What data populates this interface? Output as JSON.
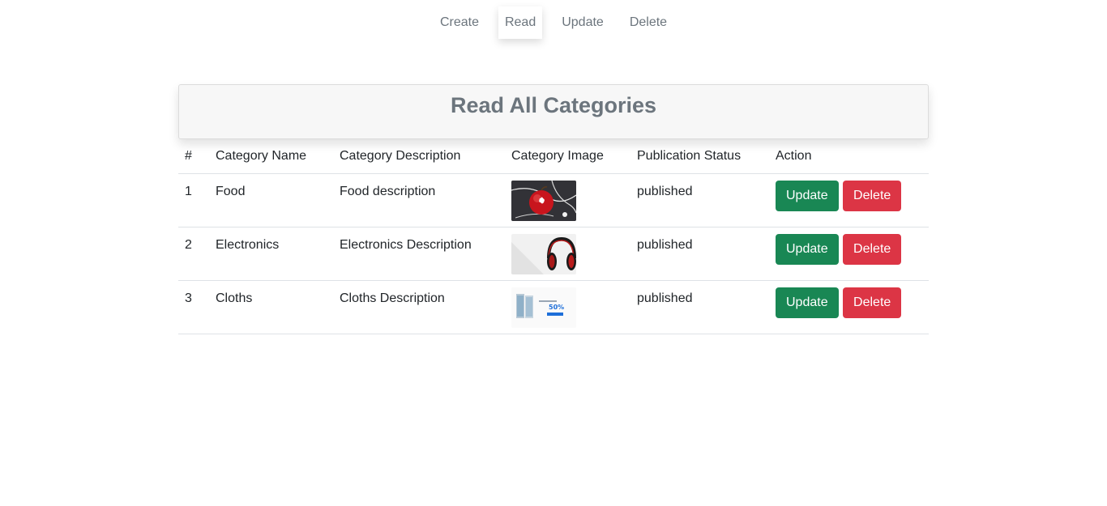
{
  "nav": {
    "items": [
      {
        "label": "Create",
        "active": false
      },
      {
        "label": "Read",
        "active": true
      },
      {
        "label": "Update",
        "active": false
      },
      {
        "label": "Delete",
        "active": false
      }
    ]
  },
  "page": {
    "title": "Read All Categories"
  },
  "table": {
    "headers": [
      "#",
      "Category Name",
      "Category Description",
      "Category Image",
      "Publication Status",
      "Action"
    ],
    "rows": [
      {
        "num": "1",
        "name": "Food",
        "description": "Food description",
        "image": "apple-earphones-image",
        "status": "published"
      },
      {
        "num": "2",
        "name": "Electronics",
        "description": "Electronics Description",
        "image": "headphones-image",
        "status": "published"
      },
      {
        "num": "3",
        "name": "Cloths",
        "description": "Cloths Description",
        "image": "sale-banner-image",
        "status": "published"
      }
    ],
    "update_label": "Update",
    "delete_label": "Delete"
  },
  "colors": {
    "update": "#198754",
    "delete": "#dc3545",
    "muted": "#6c757d"
  }
}
